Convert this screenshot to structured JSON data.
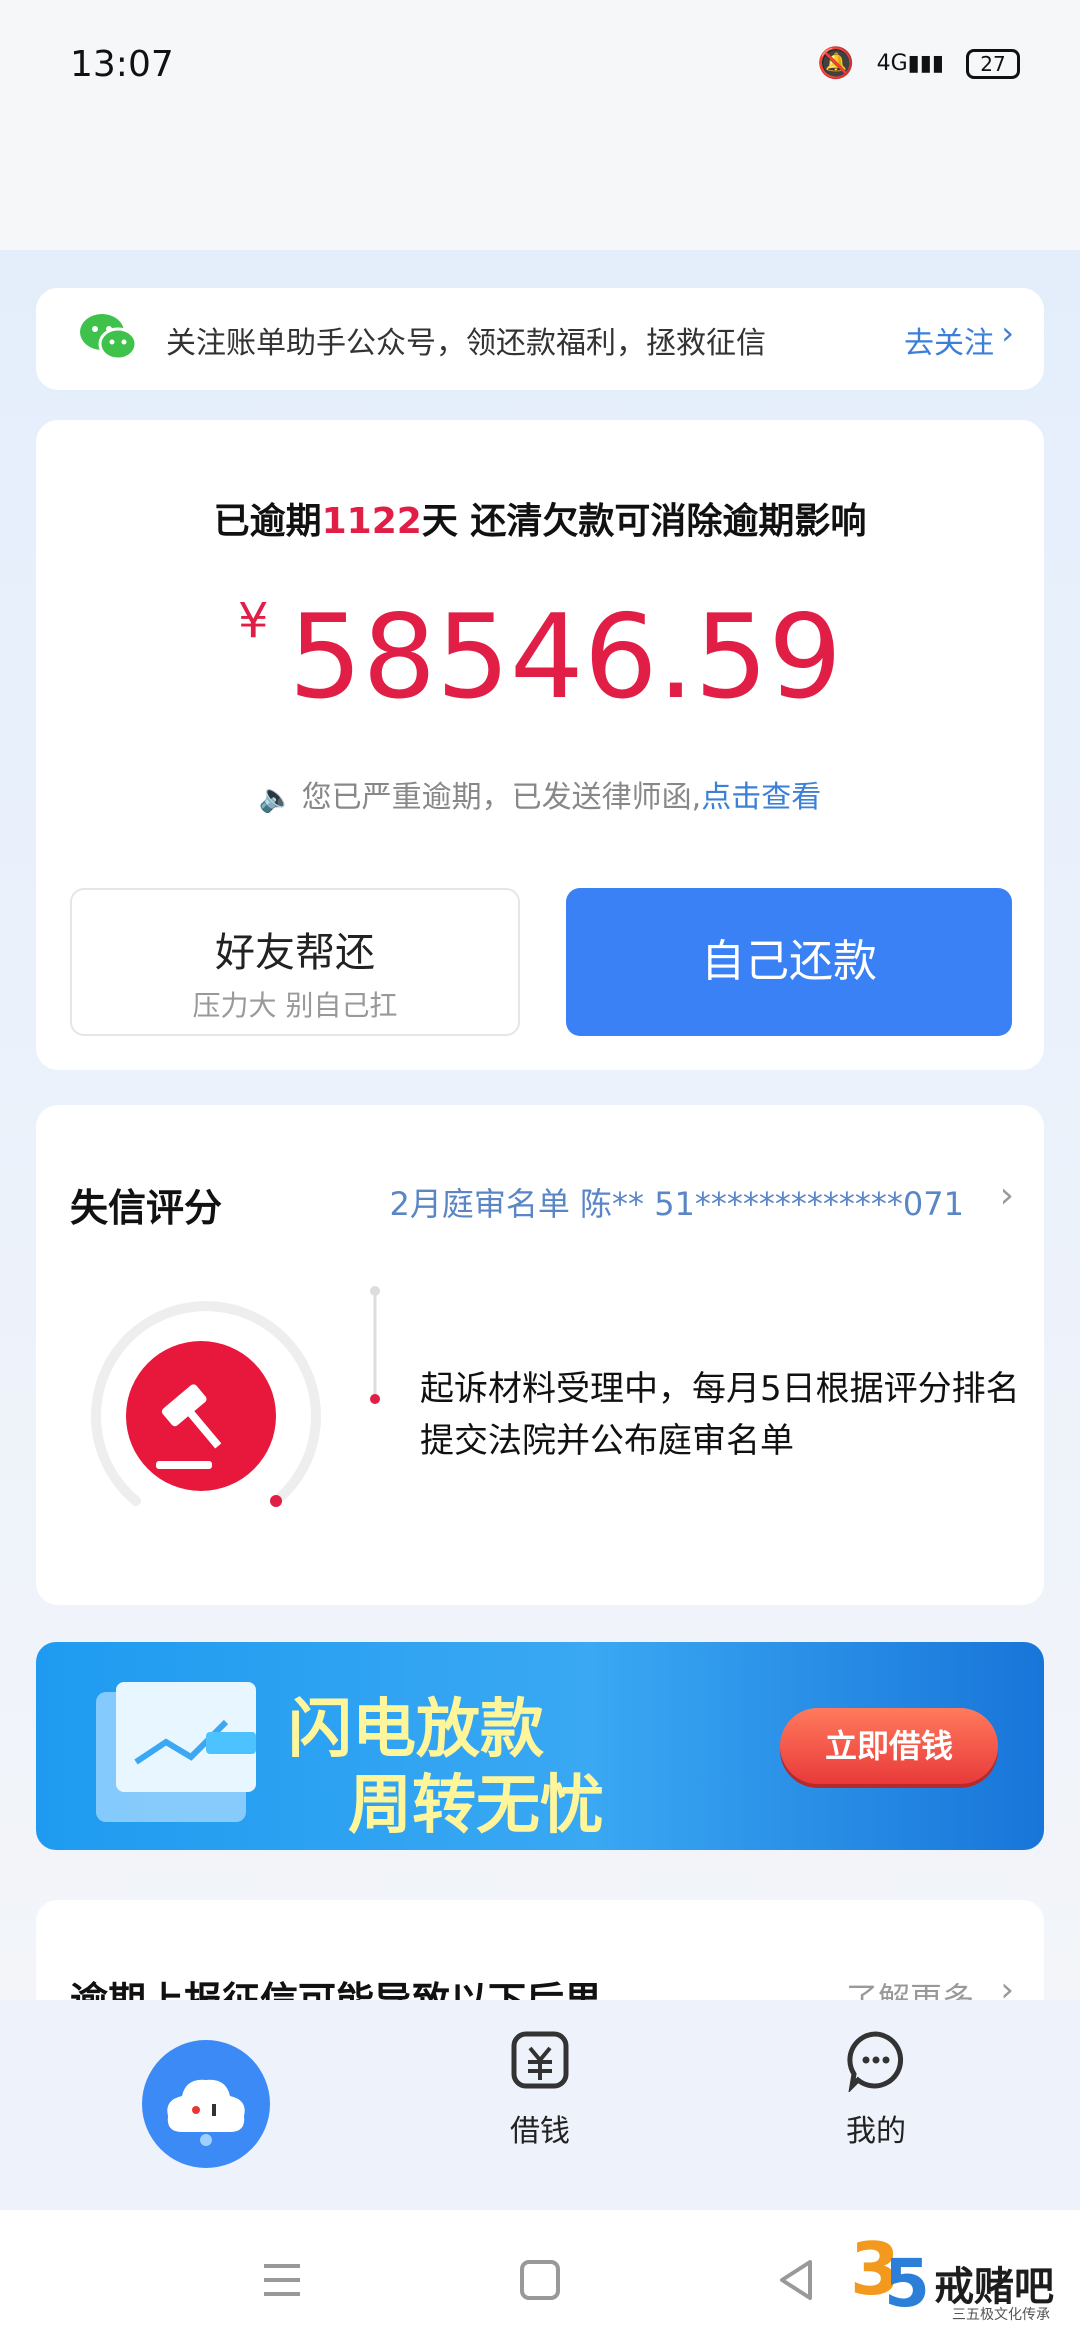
{
  "status_bar": {
    "time": "13:07",
    "network": "4G",
    "battery": "27"
  },
  "follow_bar": {
    "text": "关注账单助手公众号，领还款福利，拯救征信",
    "link": "去关注"
  },
  "debt": {
    "overdue_prefix": "已逾期",
    "overdue_days": "1122",
    "overdue_suffix": "天 还清欠款可消除逾期影响",
    "currency": "¥",
    "amount": "58546.59",
    "notice_text": "您已严重逾期，已发送律师函,",
    "notice_link": "点击查看",
    "friend_button": "好友帮还",
    "friend_sub": "压力大 别自己扛",
    "self_button": "自己还款"
  },
  "credit": {
    "title": "失信评分",
    "list_text": "2月庭审名单 陈** 51*************071",
    "description": "起诉材料受理中，每月5日根据评分排名提交法院并公布庭审名单"
  },
  "banner": {
    "title_line1": "闪电放款",
    "title_line2": "周转无忧",
    "button": "立即借钱"
  },
  "consequences": {
    "title": "逾期上报征信可能导致以下后果",
    "more": "了解更多"
  },
  "tabbar": {
    "loan": "借钱",
    "mine": "我的"
  },
  "watermark": {
    "text": "戒赌吧",
    "sub": "三五极文化传承"
  },
  "colors": {
    "accent_blue": "#3a81f5",
    "alert_red": "#e01e46",
    "link_blue": "#3b7fd9"
  }
}
